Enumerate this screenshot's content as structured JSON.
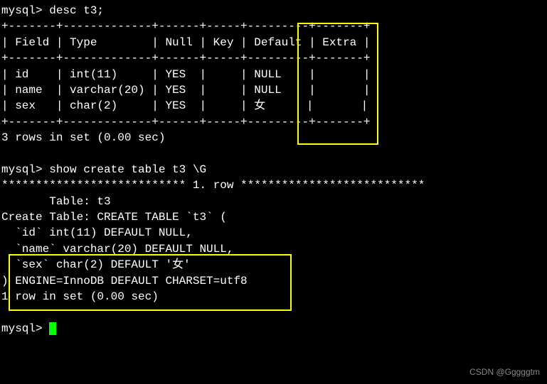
{
  "prompt1": "mysql> desc t3;",
  "table": {
    "border_top": "+-------+-------------+------+-----+---------+-------+",
    "header": "| Field | Type        | Null | Key | Default | Extra |",
    "border_mid": "+-------+-------------+------+-----+---------+-------+",
    "row1": "| id    | int(11)     | YES  |     | NULL    |       |",
    "row2": "| name  | varchar(20) | YES  |     | NULL    |       |",
    "row3": "| sex   | char(2)     | YES  |     | 女      |       |",
    "border_bot": "+-------+-------------+------+-----+---------+-------+"
  },
  "rows_msg1": "3 rows in set (0.00 sec)",
  "blank1": "",
  "prompt2": "mysql> show create table t3 \\G",
  "star_row": "*************************** 1. row ***************************",
  "table_label": "       Table: t3",
  "create_label": "Create Table: CREATE TABLE `t3` (",
  "def1": "  `id` int(11) DEFAULT NULL,",
  "def2": "  `name` varchar(20) DEFAULT NULL,",
  "def3": "  `sex` char(2) DEFAULT '女'",
  "def_end": ") ENGINE=InnoDB DEFAULT CHARSET=utf8",
  "rows_msg2": "1 row in set (0.00 sec)",
  "blank2": "",
  "prompt3": "mysql> ",
  "watermark": "CSDN @Gggggtm"
}
